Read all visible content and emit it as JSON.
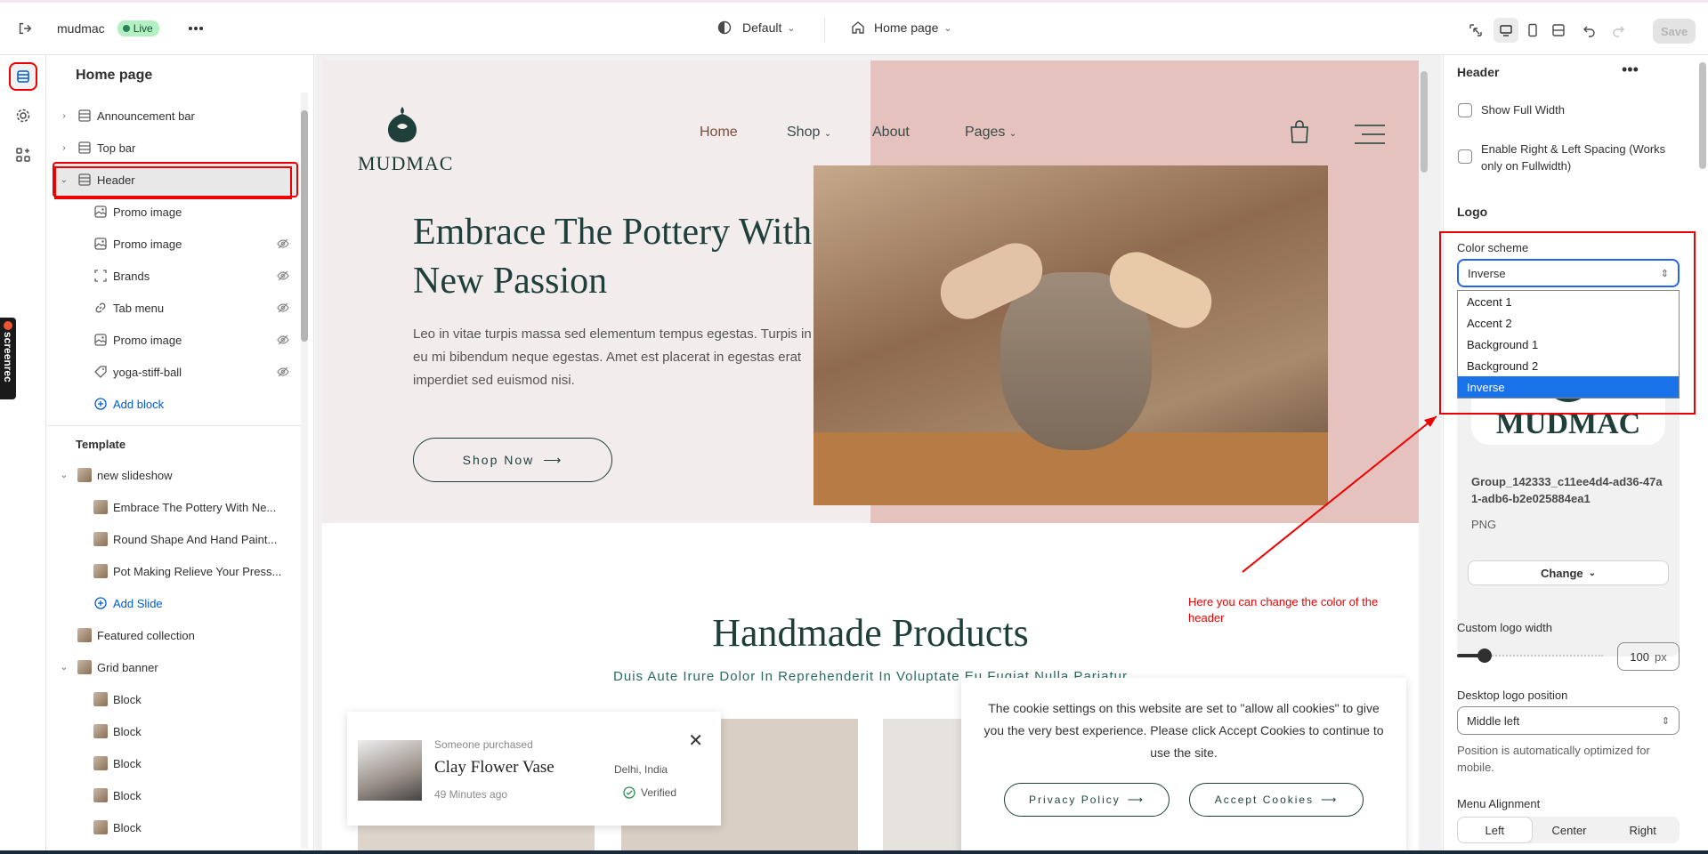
{
  "topbar": {
    "store_name": "mudmac",
    "live_label": "Live",
    "theme_label": "Default",
    "page_label": "Home page",
    "save_label": "Save"
  },
  "left_panel": {
    "title": "Home page",
    "header_sections": [
      {
        "label": "Announcement bar",
        "icon": "section-icon",
        "caret": true
      },
      {
        "label": "Top bar",
        "icon": "section-icon",
        "caret": true
      },
      {
        "label": "Header",
        "icon": "section-icon",
        "caret": true,
        "selected": true
      },
      {
        "label": "Promo image",
        "icon": "image-icon",
        "hidden": false
      },
      {
        "label": "Promo image",
        "icon": "image-icon",
        "hidden": true
      },
      {
        "label": "Brands",
        "icon": "frame-icon",
        "hidden": true
      },
      {
        "label": "Tab menu",
        "icon": "link-icon",
        "hidden": true
      },
      {
        "label": "Promo image",
        "icon": "image-icon",
        "hidden": true
      },
      {
        "label": "yoga-stiff-ball",
        "icon": "tag-icon",
        "hidden": true
      }
    ],
    "add_block_label": "Add block",
    "template_label": "Template",
    "template_items": [
      {
        "label": "new slideshow",
        "caret": true,
        "indent": 0
      },
      {
        "label": "Embrace The Pottery With Ne...",
        "indent": 1
      },
      {
        "label": "Round Shape And Hand Paint...",
        "indent": 1
      },
      {
        "label": "Pot Making Relieve Your Press...",
        "indent": 1
      }
    ],
    "add_slide_label": "Add Slide",
    "more_items": [
      {
        "label": "Featured collection",
        "caret": false,
        "indent": 0
      },
      {
        "label": "Grid banner",
        "caret": true,
        "indent": 0
      },
      {
        "label": "Block",
        "indent": 1
      },
      {
        "label": "Block",
        "indent": 1
      },
      {
        "label": "Block",
        "indent": 1
      },
      {
        "label": "Block",
        "indent": 1
      },
      {
        "label": "Block",
        "indent": 1
      }
    ]
  },
  "preview": {
    "logo_text": "MUDMAC",
    "nav": [
      "Home",
      "Shop",
      "About",
      "Pages"
    ],
    "hero_title": "Embrace The Pottery With New Passion",
    "hero_text": "Leo in vitae turpis massa sed elementum tempus egestas. Turpis in eu mi bibendum neque egestas. Amet est placerat in egestas erat imperdiet sed euismod nisi.",
    "shop_button": "Shop Now",
    "products_title": "Handmade Products",
    "products_sub": "Duis Aute Irure Dolor In Reprehenderit In Voluptate Eu Fugiat Nulla Pariatur",
    "toast": {
      "who": "Someone purchased",
      "product": "Clay Flower Vase",
      "ago": "49 Minutes ago",
      "location": "Delhi, India",
      "verified": "Verified"
    },
    "cookie": {
      "message": "The cookie settings on this website are set to \"allow all cookies\" to give you the very best experience. Please click Accept Cookies to continue to use the site.",
      "privacy": "Privacy Policy",
      "accept": "Accept Cookies"
    }
  },
  "annotation": {
    "text": "Here you can change the color of the header",
    "color": "#e00000"
  },
  "right_panel": {
    "title": "Header",
    "show_full_width": "Show Full Width",
    "enable_spacing": "Enable Right & Left Spacing (Works only on Fullwidth)",
    "logo_heading": "Logo",
    "color_scheme_label": "Color scheme",
    "color_scheme_value": "Inverse",
    "color_scheme_options": [
      "Accent 1",
      "Accent 2",
      "Background 1",
      "Background 2",
      "Inverse"
    ],
    "logo_file_name": "Group_142333_c11ee4d4-ad36-47a1-adb6-b2e025884ea1",
    "logo_file_type": "PNG",
    "logo_preview_text": "MUDMAC",
    "change_label": "Change",
    "logo_width_label": "Custom logo width",
    "logo_width_value": "100",
    "logo_width_unit": "px",
    "logo_width_fraction": 0.19,
    "desktop_pos_label": "Desktop logo position",
    "desktop_pos_value": "Middle left",
    "desktop_pos_help": "Position is automatically optimized for mobile.",
    "menu_alignment_label": "Menu Alignment",
    "menu_alignment_options": [
      "Left",
      "Center",
      "Right"
    ],
    "menu_alignment_selected": "Left"
  }
}
